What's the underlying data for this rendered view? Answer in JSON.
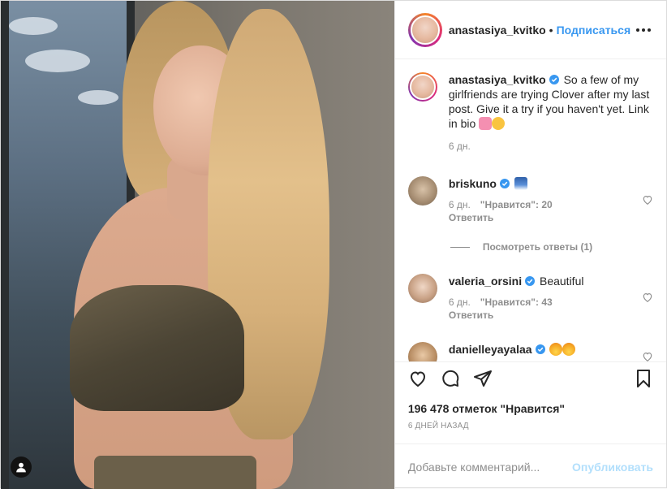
{
  "post": {
    "author": "anastasiya_kvitko",
    "header_username": "anastasiya_kvitko",
    "separator": "•",
    "follow_label": "Подписаться",
    "caption_text": "So a few of my girlfriends are trying Clover after my last post. Give it a try if you haven't yet. Link in bio",
    "caption_time": "6 дн.",
    "likes": "196 478 отметок \"Нравится\"",
    "posted_ago": "6 ДНЕЙ НАЗАД"
  },
  "comments": [
    {
      "username": "briskuno",
      "verified": true,
      "text": "",
      "emoji": "wave-emoji",
      "time": "6 дн.",
      "likes": "\"Нравится\": 20",
      "reply_label": "Ответить"
    },
    {
      "username": "valeria_orsini",
      "verified": true,
      "text": "Beautiful",
      "time": "6 дн.",
      "likes": "\"Нравится\": 43",
      "reply_label": "Ответить"
    },
    {
      "username": "danielleyayalaa",
      "verified": true,
      "text": "",
      "emoji": "fire-emoji"
    }
  ],
  "view_replies_label": "Посмотреть ответы (1)",
  "comment_box": {
    "placeholder": "Добавьте комментарий...",
    "publish_label": "Опубликовать"
  },
  "colors": {
    "link_blue": "#3897f0",
    "publish_disabled": "#b2dffc",
    "muted": "#8e8e8e",
    "verified_blue": "#3897f0"
  },
  "icons": [
    "more-options-icon",
    "verified-icon",
    "heart-icon",
    "comment-icon",
    "share-icon",
    "bookmark-icon",
    "user-tag-icon"
  ]
}
